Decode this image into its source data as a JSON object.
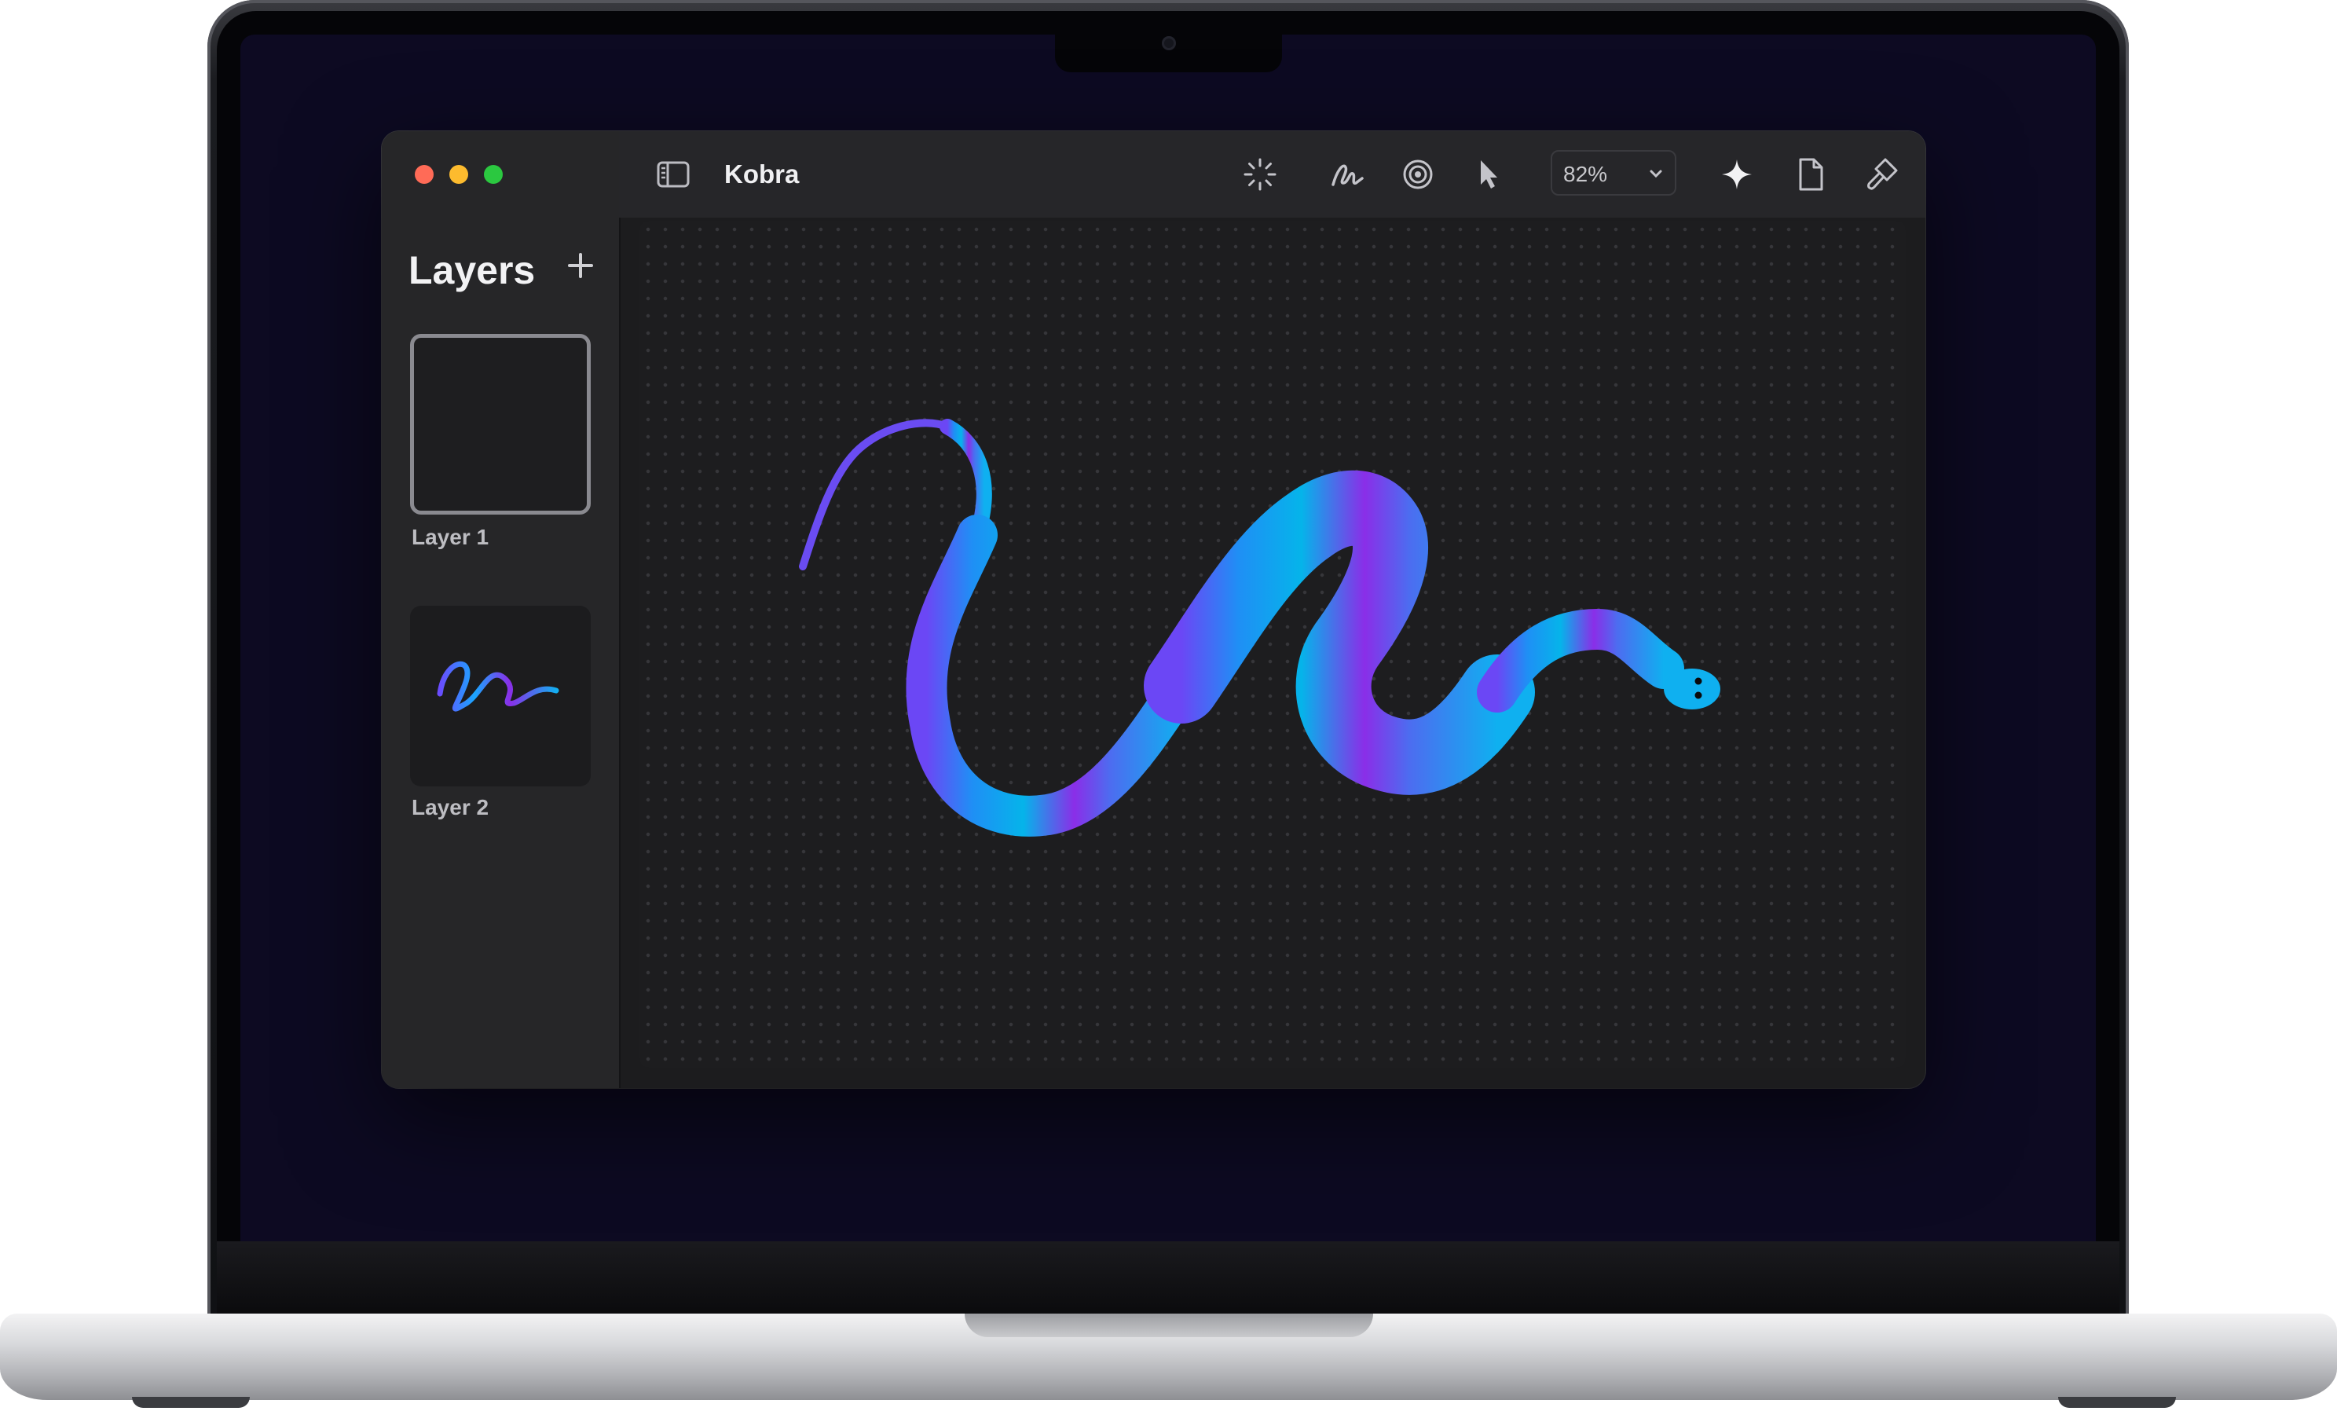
{
  "window": {
    "document_title": "Kobra"
  },
  "sidebar": {
    "title": "Layers",
    "add_icon": "plus-icon",
    "layers": [
      {
        "label": "Layer 1",
        "selected": true,
        "empty": true
      },
      {
        "label": "Layer 2",
        "selected": false,
        "empty": false
      }
    ]
  },
  "toolbar": {
    "sidebar_toggle_icon": "sidebar-icon",
    "tools": [
      "spinner-icon",
      "pen-squiggle-icon",
      "target-icon",
      "pointer-icon"
    ],
    "zoom": {
      "value": "82%"
    },
    "actions": [
      "sparkle-icon",
      "document-icon",
      "brush-icon"
    ]
  },
  "canvas": {
    "stroke_colors": [
      "#6c4bff",
      "#1aa0ff",
      "#00b8ec",
      "#8a2ee8"
    ]
  }
}
